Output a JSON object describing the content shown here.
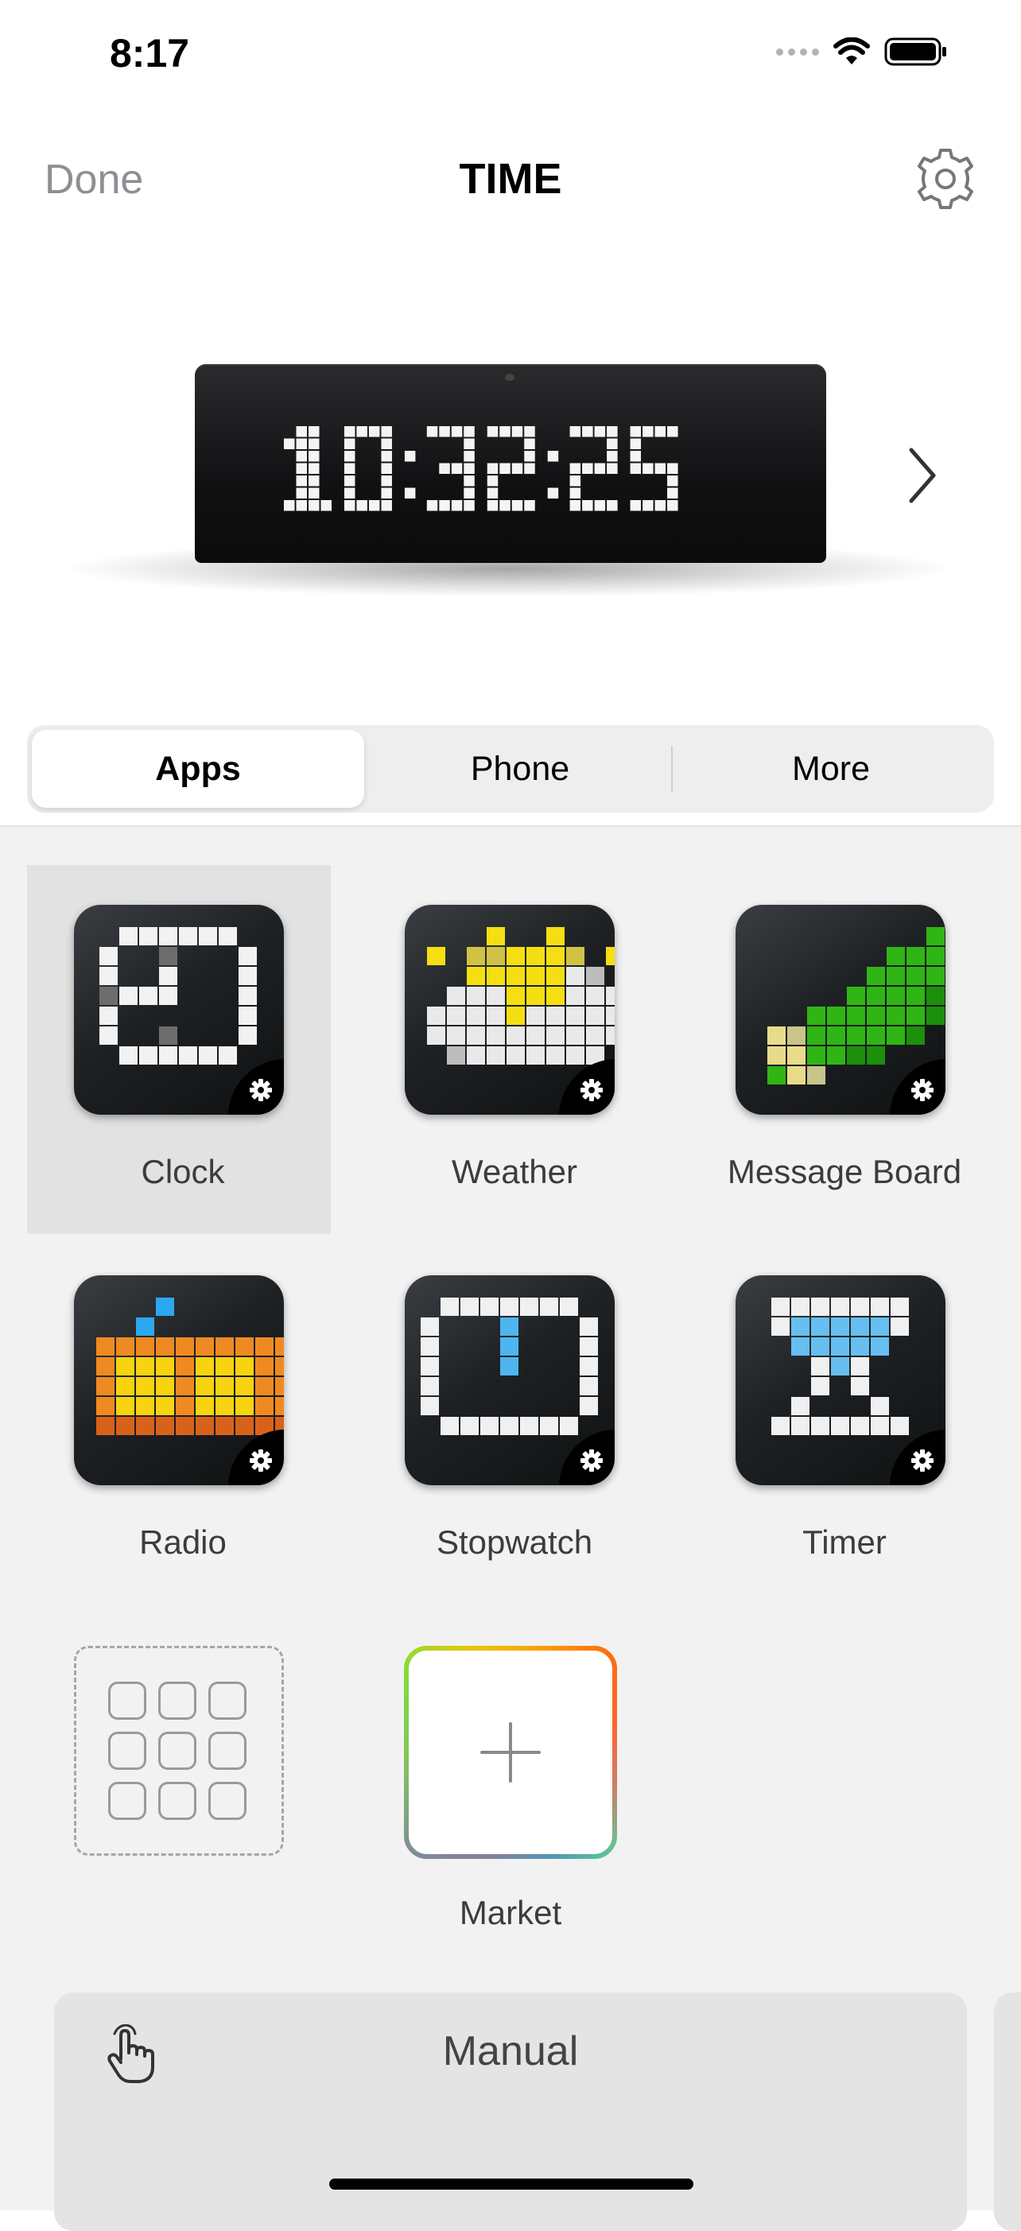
{
  "status_bar": {
    "time": "8:17"
  },
  "nav": {
    "done_label": "Done",
    "title": "TIME"
  },
  "device": {
    "display_text": "10:32:25"
  },
  "segmented": {
    "tabs": [
      "Apps",
      "Phone",
      "More"
    ],
    "selected": "Apps"
  },
  "apps": [
    {
      "label": "Clock",
      "icon": "clock-pixel-icon",
      "selected": true
    },
    {
      "label": "Weather",
      "icon": "weather-pixel-icon"
    },
    {
      "label": "Message Board",
      "icon": "message-board-pixel-icon"
    },
    {
      "label": "Radio",
      "icon": "radio-pixel-icon"
    },
    {
      "label": "Stopwatch",
      "icon": "stopwatch-pixel-icon"
    },
    {
      "label": "Timer",
      "icon": "timer-pixel-icon"
    },
    {
      "label": "",
      "icon": "app-grid-icon"
    },
    {
      "label": "Market",
      "icon": "plus-icon"
    }
  ],
  "manual": {
    "label": "Manual",
    "icon": "hand-pointer-icon"
  },
  "colors": {
    "accent_gear": "#ffffff",
    "tile_bg": "#1e2124",
    "selected_cell": "#e2e2e2"
  }
}
